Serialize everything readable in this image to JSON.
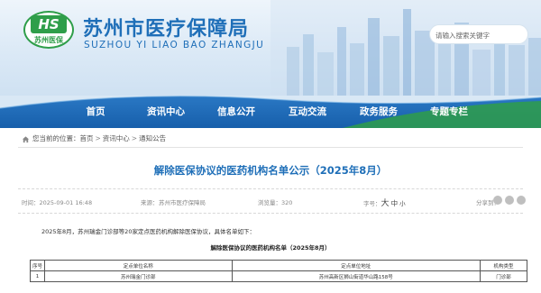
{
  "header": {
    "logo_text": "HS",
    "logo_sub": "苏州医保",
    "title": "苏州市医疗保障局",
    "subtitle": "SUZHOU YI LIAO BAO ZHANGJU",
    "search_placeholder": "请输入搜索关键字"
  },
  "nav": {
    "items": [
      "首页",
      "资讯中心",
      "信息公开",
      "互动交流",
      "政务服务",
      "专题专栏"
    ]
  },
  "breadcrumb": {
    "label": "您当前的位置：",
    "items": [
      "首页",
      "资讯中心",
      "通知公告"
    ],
    "separator": ">"
  },
  "article": {
    "title": "解除医保协议的医药机构名单公示（2025年8月）",
    "date": "时间：2025-09-01 16:48",
    "source_label": "来源：",
    "source": "苏州市医疗保障局",
    "views": "浏览量：320",
    "font_label": "字号：",
    "font_big": "大",
    "font_mid": "中",
    "font_small": "小",
    "share_label": "分享到：",
    "intro": "2025年8月，苏州瑞金门诊部等20家定点医药机构解除医保协议，具体名单如下：",
    "table_title": "解除医保协议的医药机构名单（2025年8月）"
  },
  "table": {
    "headers": [
      "序号",
      "定点单位名称",
      "定点单位地址",
      "机构类型"
    ],
    "rows": [
      [
        "1",
        "苏州瑞金门诊部",
        "苏州高新区狮山街道华山路158号",
        "门诊部"
      ]
    ]
  },
  "colors": {
    "brand_blue": "#1f6fb8",
    "nav_blue": "#1a63b0",
    "nav_green": "#2f9e4a",
    "logo_green": "#2f9e4a"
  },
  "icons": [
    "home-icon",
    "wechat-icon",
    "weibo-icon",
    "qq-icon",
    "share-icon"
  ]
}
